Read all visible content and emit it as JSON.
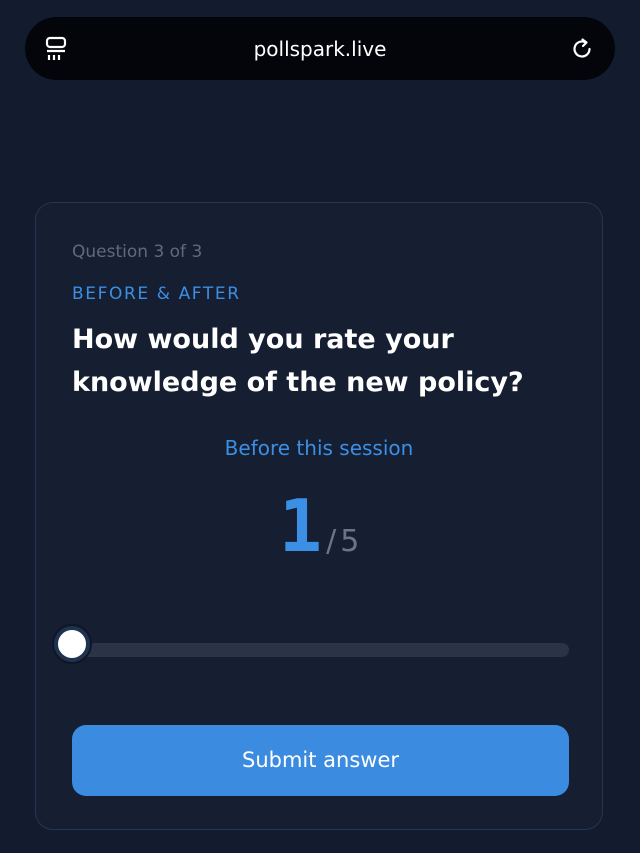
{
  "browser": {
    "url": "pollspark.live",
    "tabs_icon": "tabs-icon",
    "reload_icon": "reload-icon"
  },
  "poll": {
    "counter": "Question 3 of 3",
    "category": "BEFORE & AFTER",
    "question": "How would you rate your knowledge of the new policy?",
    "scale_label": "Before this session",
    "rating": {
      "value": "1",
      "separator": "/",
      "max": "5",
      "min_value": 1,
      "max_value": 5,
      "current": 1
    },
    "submit_label": "Submit answer"
  },
  "colors": {
    "background": "#131c2e",
    "accent": "#3b8fe4",
    "button": "#3b8be0",
    "muted": "#5e6a7f"
  }
}
